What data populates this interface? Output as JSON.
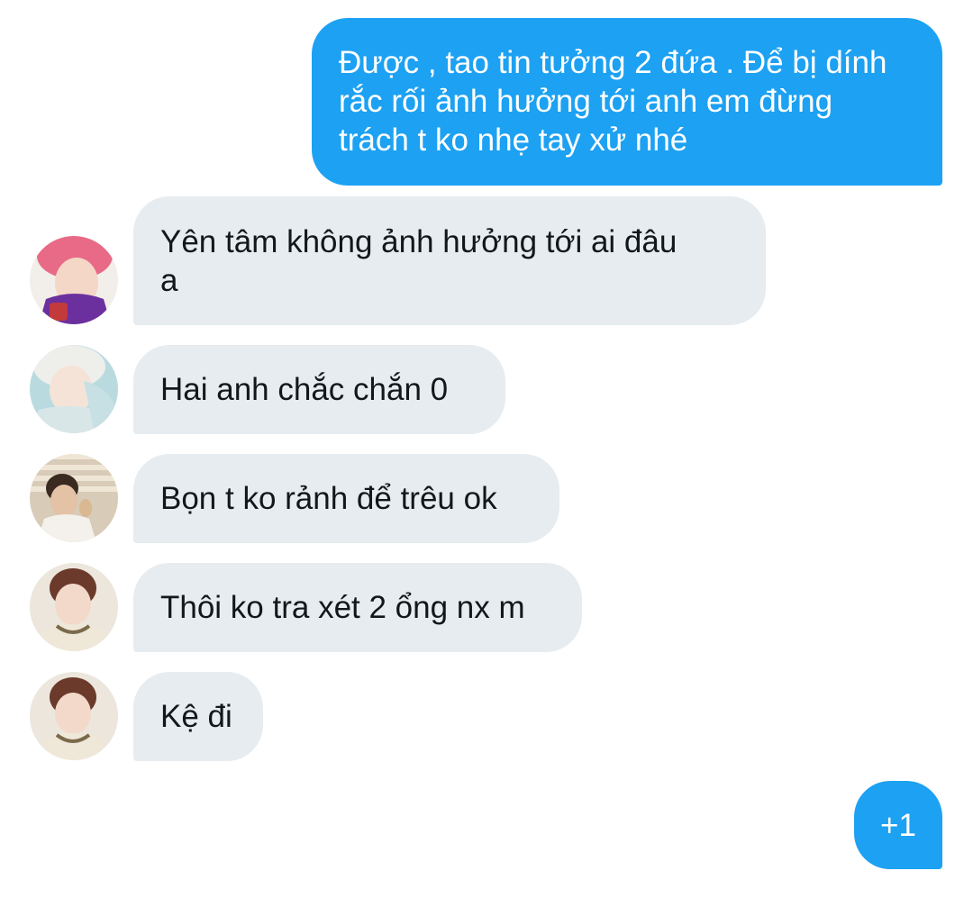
{
  "messages": [
    {
      "sender": "self",
      "text": "Được , tao tin tưởng 2 đứa . Để bị dính\nrắc rối ảnh hưởng tới anh em đừng\ntrách t ko nhẹ tay xử nhé"
    },
    {
      "sender": "other",
      "avatar": "pink-hair-avatar",
      "text": "Yên tâm không ảnh hưởng tới ai đâu\na"
    },
    {
      "sender": "other",
      "avatar": "white-hair-avatar",
      "text": "Hai anh chắc chắn 0"
    },
    {
      "sender": "other",
      "avatar": "window-light-avatar",
      "text": "Bọn t ko rảnh để trêu ok"
    },
    {
      "sender": "other",
      "avatar": "brown-hair-avatar",
      "text": "Thôi ko tra xét 2 ổng nx m"
    },
    {
      "sender": "other",
      "avatar": "brown-hair-avatar",
      "text": "Kệ đi"
    },
    {
      "sender": "self",
      "text": "+1"
    }
  ],
  "colors": {
    "outgoing_bubble": "#1da1f2",
    "incoming_bubble": "#e6ecf0",
    "background": "#ffffff"
  }
}
